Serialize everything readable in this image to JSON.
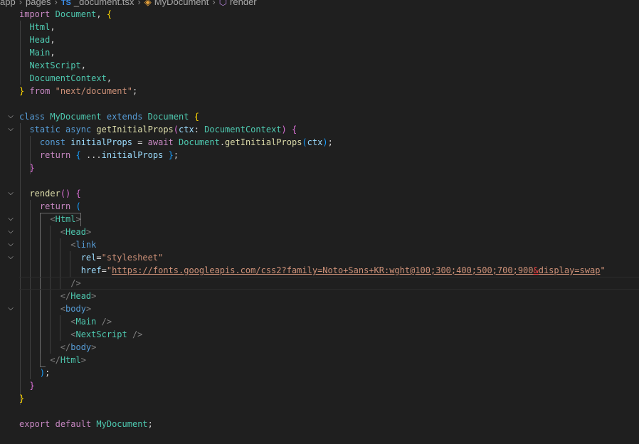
{
  "breadcrumb": {
    "seg_app": "app",
    "seg_pages": "pages",
    "file_icon": "TS",
    "file_name": "_document.tsx",
    "class_name": "MyDocument",
    "method_name": "render",
    "icons": [
      "typescript-file-icon",
      "class-icon",
      "method-icon"
    ]
  },
  "code": {
    "import_kw": "import",
    "document": "Document",
    "imp_html": "Html",
    "imp_head": "Head",
    "imp_main": "Main",
    "imp_nextscript": "NextScript",
    "imp_documentcontext": "DocumentContext",
    "from_kw": "from",
    "module_path": "\"next/document\"",
    "class_kw": "class",
    "class_name": "MyDocument",
    "extends_kw": "extends",
    "static_kw": "static",
    "async_kw": "async",
    "method_getinitialprops": "getInitialProps",
    "param_ctx": "ctx",
    "const_kw": "const",
    "var_initialprops": "initialProps",
    "await_kw": "await",
    "return_kw": "return",
    "render_fn": "render",
    "tag_html": "Html",
    "tag_head": "Head",
    "tag_link": "link",
    "attr_rel": "rel",
    "rel_value": "\"stylesheet\"",
    "attr_href": "href",
    "href_value_a": "https://fonts.googleapis.com/css2?family=Noto+Sans+KR:wght@100;300;400;500;700;900",
    "href_value_amp": "&",
    "href_value_b": "display=swap",
    "tag_body": "body",
    "tag_main": "Main",
    "tag_nextscript": "NextScript",
    "export_kw": "export",
    "default_kw": "default"
  },
  "colors": {
    "background": "#1f1f1f",
    "keyword": "#c586c0",
    "storage": "#569cd6",
    "type": "#4ec9b0",
    "function": "#dcdcaa",
    "variable": "#9cdcfe",
    "string": "#ce9178"
  }
}
